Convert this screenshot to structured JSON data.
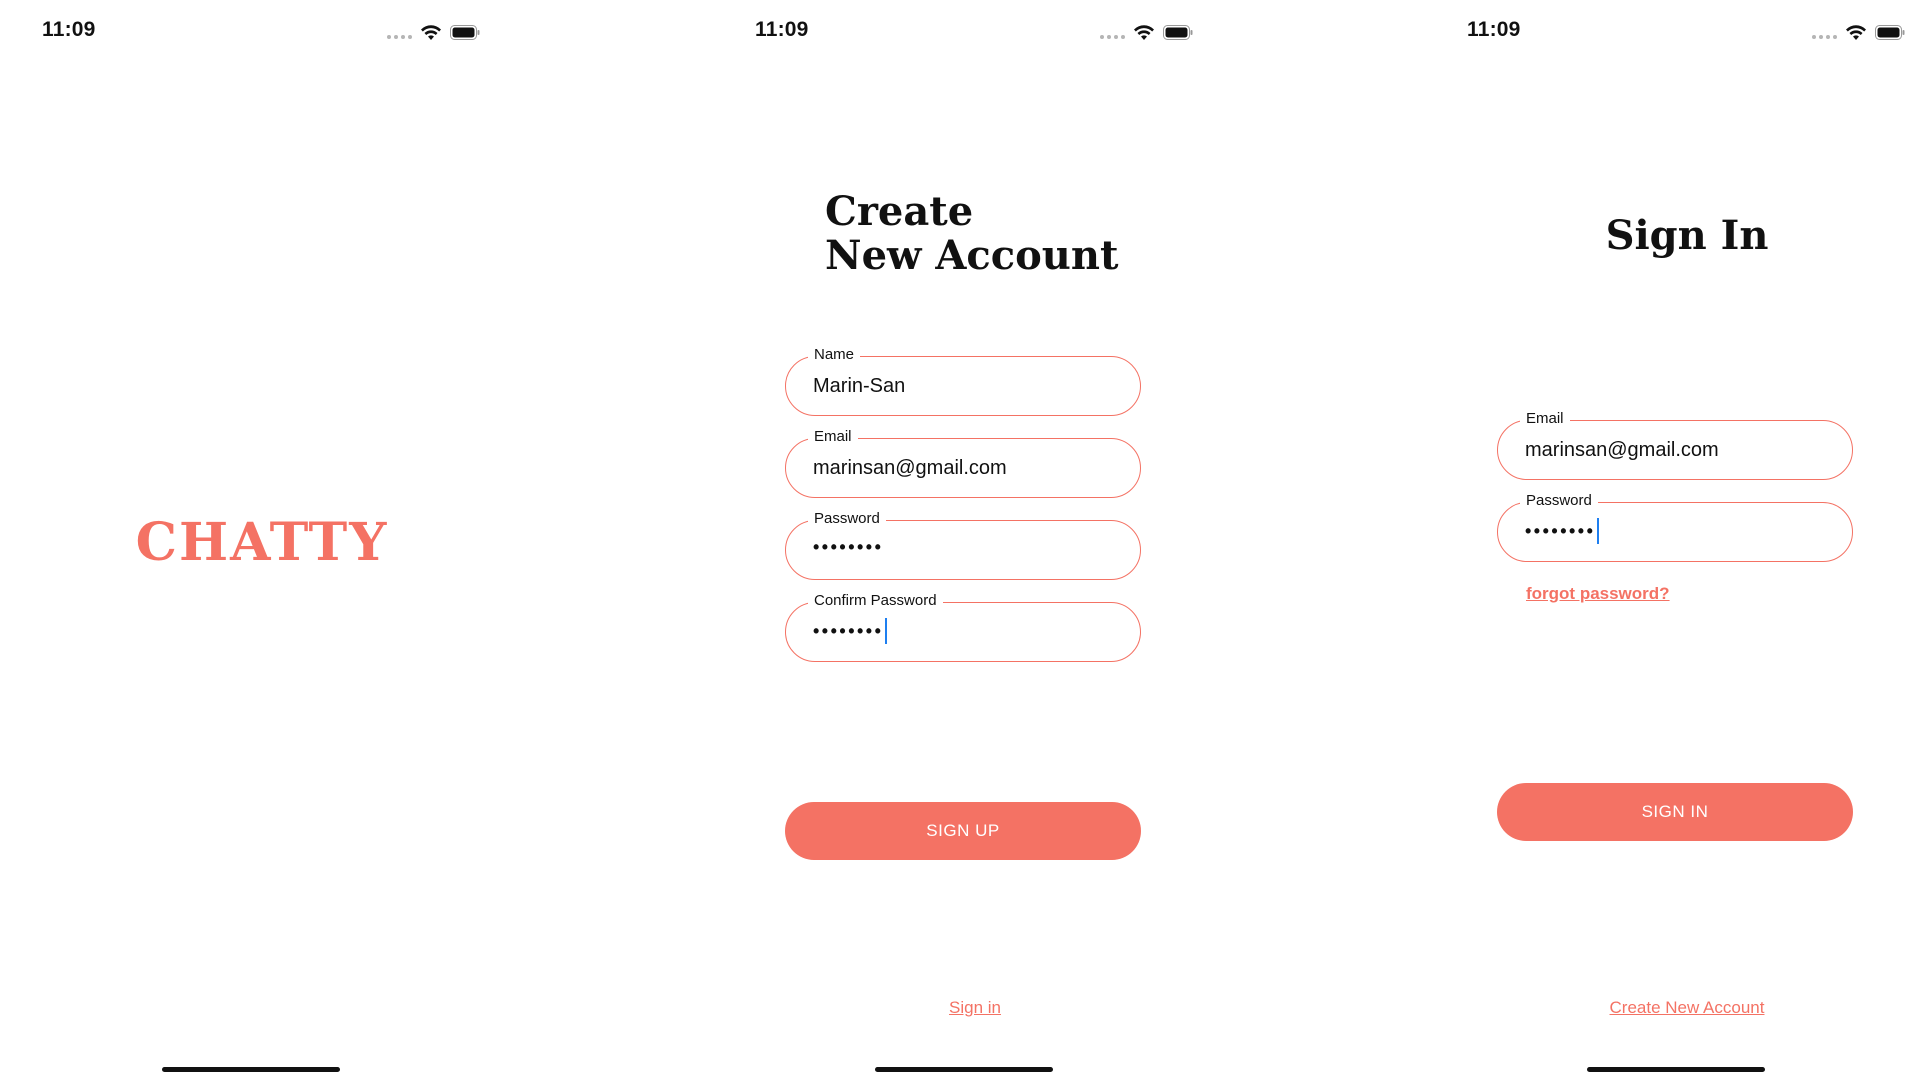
{
  "theme": {
    "accent": "#f47264",
    "text": "#111111",
    "caret": "#1e7ff0"
  },
  "screens": [
    {
      "status": {
        "time": "11:09"
      },
      "logo": "CHATTY"
    },
    {
      "status": {
        "time": "11:09"
      },
      "title_line1": "Create",
      "title_line2": "New Account",
      "fields": {
        "name": {
          "label": "Name",
          "value": "Marin-San"
        },
        "email": {
          "label": "Email",
          "value": "marinsan@gmail.com"
        },
        "password": {
          "label": "Password",
          "value": "••••••••"
        },
        "confirm": {
          "label": "Confirm Password",
          "value": "••••••••"
        }
      },
      "button": "SIGN UP",
      "link": "Sign in"
    },
    {
      "status": {
        "time": "11:09"
      },
      "title": "Sign In",
      "fields": {
        "email": {
          "label": "Email",
          "value": "marinsan@gmail.com"
        },
        "password": {
          "label": "Password",
          "value": "••••••••"
        }
      },
      "forgot": "forgot password?",
      "button": "SIGN IN",
      "link": "Create New Account"
    }
  ],
  "icons": [
    "signal-dots-icon",
    "wifi-icon",
    "battery-icon"
  ]
}
